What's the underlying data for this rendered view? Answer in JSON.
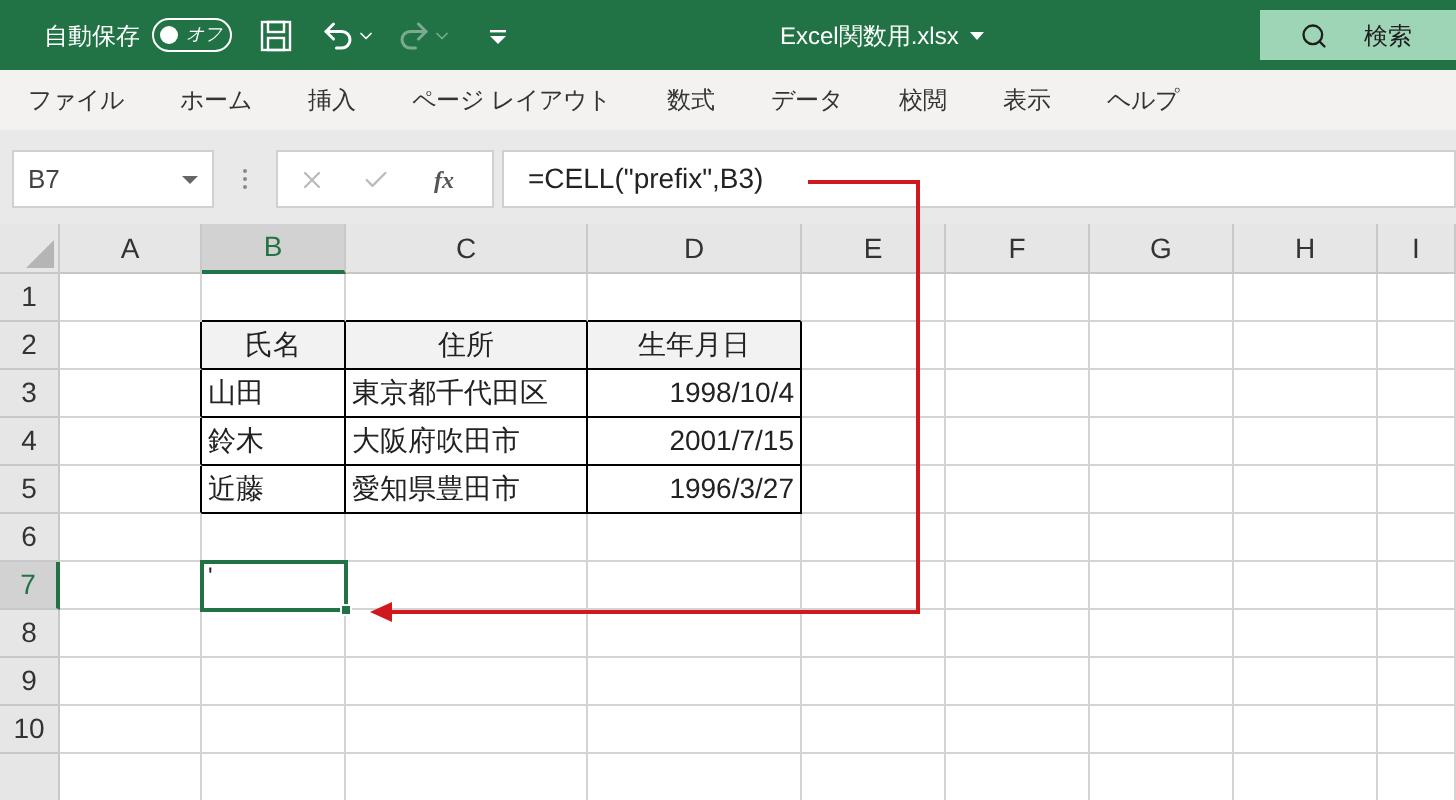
{
  "title_bar": {
    "autosave_label": "自動保存",
    "autosave_toggle": {
      "text": "オフ",
      "on": false
    },
    "filename": "Excel関数用.xlsx",
    "search": "検索"
  },
  "menu": [
    "ファイル",
    "ホーム",
    "挿入",
    "ページ レイアウト",
    "数式",
    "データ",
    "校閲",
    "表示",
    "ヘルプ"
  ],
  "formula_bar": {
    "name_box": "B7",
    "fx": "fx",
    "formula": "=CELL(\"prefix\",B3)"
  },
  "columns": [
    {
      "label": "A",
      "selected": false
    },
    {
      "label": "B",
      "selected": true
    },
    {
      "label": "C",
      "selected": false
    },
    {
      "label": "D",
      "selected": false
    },
    {
      "label": "E",
      "selected": false
    },
    {
      "label": "F",
      "selected": false
    },
    {
      "label": "G",
      "selected": false
    },
    {
      "label": "H",
      "selected": false
    },
    {
      "label": "I",
      "selected": false
    }
  ],
  "rows": [
    {
      "label": "1",
      "selected": false
    },
    {
      "label": "2",
      "selected": false
    },
    {
      "label": "3",
      "selected": false
    },
    {
      "label": "4",
      "selected": false
    },
    {
      "label": "5",
      "selected": false
    },
    {
      "label": "6",
      "selected": false
    },
    {
      "label": "7",
      "selected": true
    },
    {
      "label": "8",
      "selected": false
    },
    {
      "label": "9",
      "selected": false
    },
    {
      "label": "10",
      "selected": false
    }
  ],
  "table": {
    "headers": [
      "氏名",
      "住所",
      "生年月日"
    ],
    "rows": [
      [
        "山田",
        "東京都千代田区",
        "1998/10/4"
      ],
      [
        "鈴木",
        "大阪府吹田市",
        "2001/7/15"
      ],
      [
        "近藤",
        "愛知県豊田市",
        "1996/3/27"
      ]
    ]
  },
  "active_cell": {
    "text": "'"
  }
}
